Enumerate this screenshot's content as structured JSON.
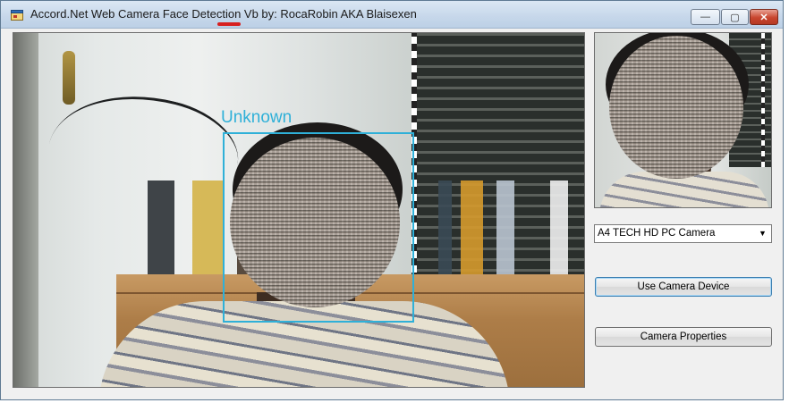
{
  "window": {
    "title": "Accord.Net Web Camera Face Detection Vb by: RocaRobin AKA Blaisexen",
    "app_icon": "app-window-icon",
    "controls": {
      "minimize_glyph": "—",
      "maximize_glyph": "▢",
      "close_glyph": "✕"
    }
  },
  "main_view": {
    "detection_label": "Unknown",
    "detection_color": "#2fb0d8"
  },
  "camera_select": {
    "selected": "A4 TECH HD PC Camera",
    "arrow_glyph": "▼"
  },
  "buttons": {
    "use_camera_label": "Use Camera Device",
    "camera_properties_label": "Camera Properties"
  }
}
